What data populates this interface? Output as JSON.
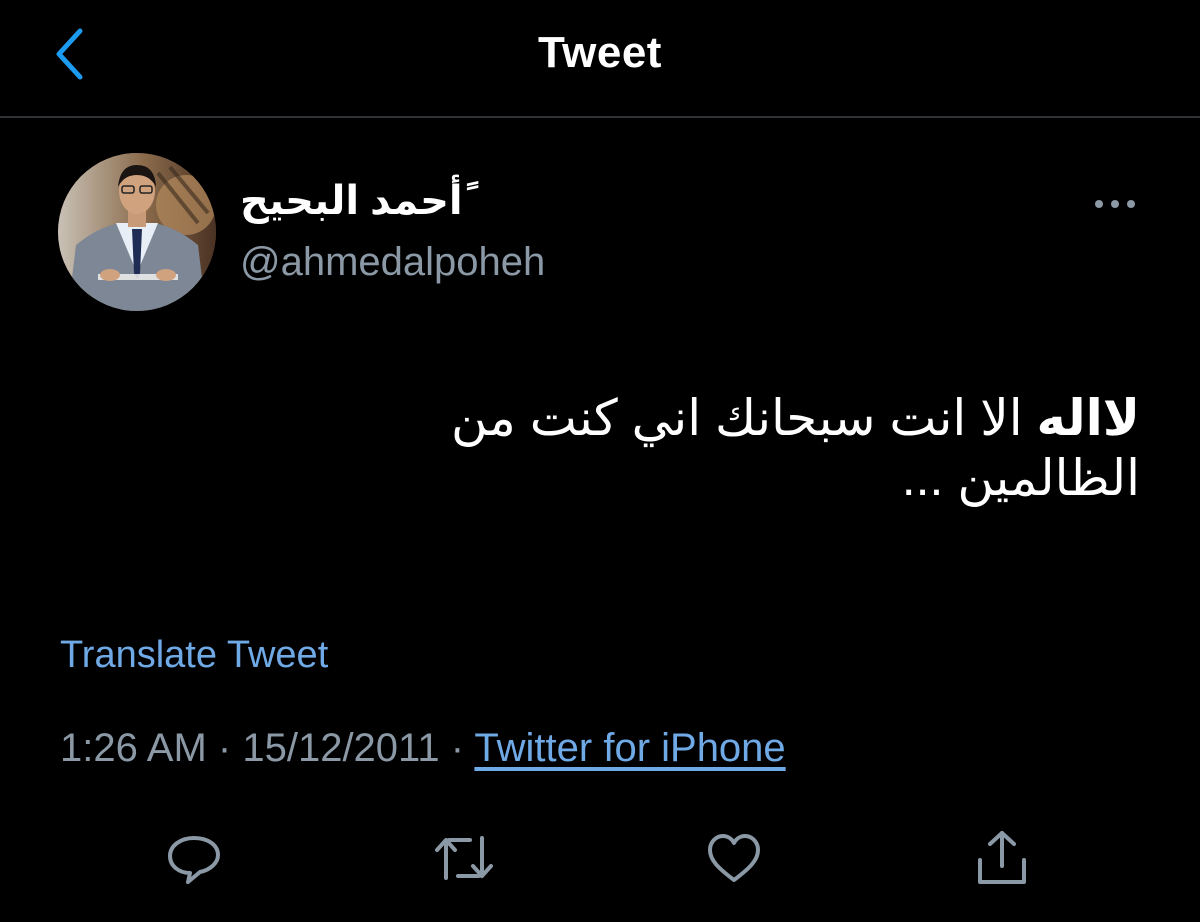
{
  "header": {
    "title": "Tweet",
    "back_icon": "chevron-left-icon"
  },
  "tweet": {
    "author": {
      "display_name": "ًأحمد البحيح",
      "handle": "@ahmedalpoheh"
    },
    "text_bold": "لااله",
    "text_rest": "الا انت سبحانك اني كنت من الظالمين ...",
    "translate_label": "Translate Tweet",
    "time": "1:26 AM",
    "separator": "·",
    "date": "15/12/2011",
    "source": "Twitter for iPhone"
  },
  "actions": {
    "reply_icon": "reply-icon",
    "retweet_icon": "retweet-icon",
    "like_icon": "heart-icon",
    "share_icon": "share-icon"
  },
  "colors": {
    "background": "#000000",
    "text": "#ffffff",
    "secondary_text": "#8b98a5",
    "link": "#6fa9e6",
    "accent": "#1d9bf0",
    "divider": "#2f3336"
  }
}
